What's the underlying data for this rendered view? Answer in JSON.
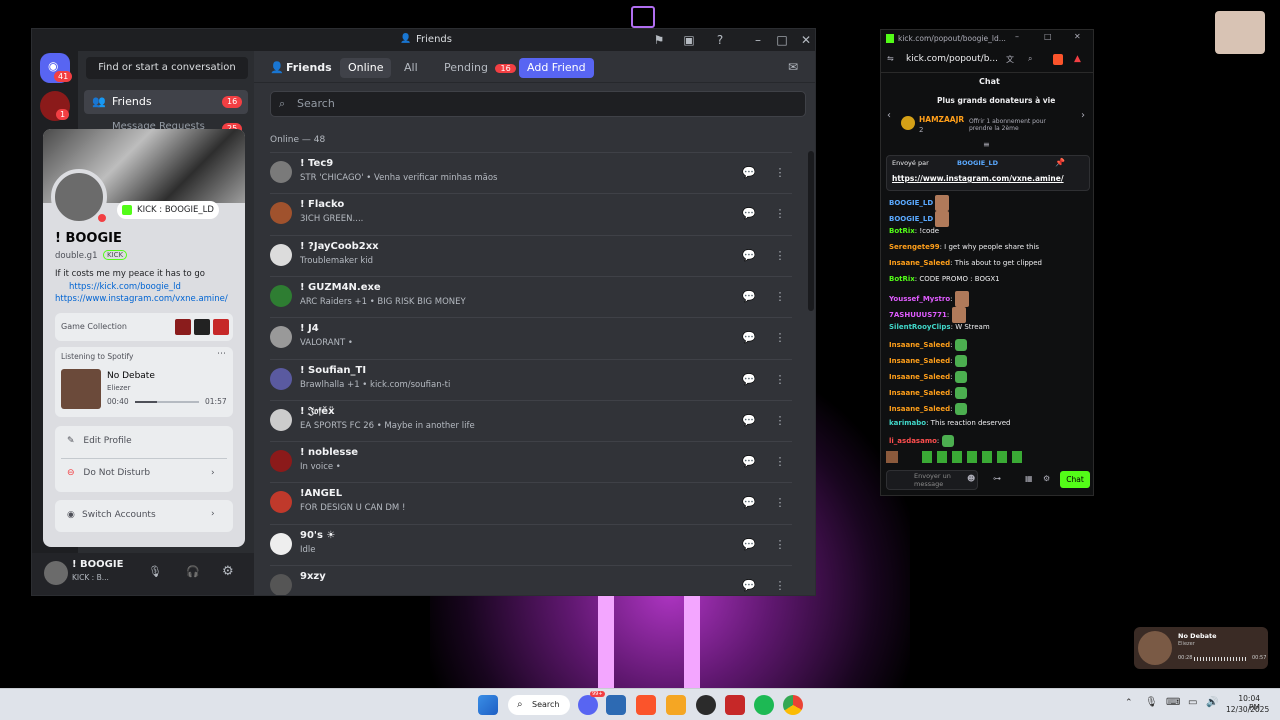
{
  "discord": {
    "window_title": "Friends",
    "server_badges": [
      "41",
      "1"
    ],
    "find_btn": "Find or start a conversation",
    "friends_label": "Friends",
    "friends_badge": "16",
    "msg_requests": "Message Requests",
    "msg_requests_badge": "25",
    "nav": {
      "friends": "Friends",
      "online": "Online",
      "all": "All",
      "pending": "Pending",
      "pending_badge": "16",
      "add_friend": "Add Friend"
    },
    "search_placeholder": "Search",
    "online_header": "Online — 48",
    "rows": [
      {
        "name": "! Tec9",
        "status": "STR 'CHICAGO' • Venha verificar minhas mãos"
      },
      {
        "name": "! Flacko",
        "status": "3ICH GREEN...."
      },
      {
        "name": "! ?JayCoob2xx",
        "status": "Troublemaker kid"
      },
      {
        "name": "! GUZM4N.exe",
        "status": "ARC Raiders +1 • BIG RISK BIG MONEY"
      },
      {
        "name": "! J4",
        "status": "VALORANT •"
      },
      {
        "name": "! Soufian_TI",
        "status": "Brawlhalla +1 • kick.com/soufian-ti"
      },
      {
        "name": "! 𝔍𝔬𝔣ĕẍ",
        "status": "EA SPORTS FC 26 • Maybe in another life"
      },
      {
        "name": "! noblesse",
        "status": "In voice •"
      },
      {
        "name": "!ANGEL",
        "status": "FOR DESIGN U CAN DM !"
      },
      {
        "name": "90's ☀",
        "status": "Idle"
      },
      {
        "name": "9xzy",
        "status": ""
      }
    ],
    "profile": {
      "kick_pill": "KICK : BOOGIE_LD",
      "name": "! BOOGIE",
      "handle": "double.g1",
      "kick_tag": "KICK",
      "bio1": "If it costs me my peace it has to go",
      "bio_link1": "https://kick.com/boogie_ld",
      "bio_link2": "https://www.instagram.com/vxne.amine/",
      "game_collection": "Game Collection",
      "spotify_label": "Listening to Spotify",
      "song": "No Debate",
      "artist": "Eliezer",
      "time_start": "00:40",
      "time_end": "01:57",
      "song_progress": 0.34,
      "edit_profile": "Edit Profile",
      "dnd": "Do Not Disturb",
      "switch_accounts": "Switch Accounts"
    },
    "user_panel": {
      "name": "! BOOGIE",
      "sub": "KICK : B..."
    }
  },
  "kick": {
    "url_title": "kick.com/popout/boogie_ld...",
    "url": "kick.com/popout/b...",
    "chat_header": "Chat",
    "donors_title": "Plus grands donateurs à vie",
    "top_donor": "HAMZAAJR",
    "top_donor_count": "2",
    "sub_offer": "Offrir 1 abonnement pour prendre la 2ème",
    "pinned_by": "Envoyé par",
    "pinned_user": "BOOGIE_LD",
    "pinned_link": "https://www.instagram.com/vxne.amine/",
    "messages": [
      {
        "user": "BOOGIE_LD",
        "text": ""
      },
      {
        "user": "BOOGIE_LD",
        "text": ""
      },
      {
        "user": "BotRix",
        "text": ": !code"
      },
      {
        "user": "Serengete99",
        "text": ": I get why people share this"
      },
      {
        "user": "Insaane_Saleed",
        "text": ": This about to get clipped"
      },
      {
        "user": "BotRix",
        "text": ": CODE PROMO : BOGX1"
      },
      {
        "user": "Youssef_Mystro",
        "text": ":"
      },
      {
        "user": "7ASHUUUS771",
        "text": ":"
      },
      {
        "user": "SilentRooyClips",
        "text": ": W Stream"
      },
      {
        "user": "Insaane_Saleed",
        "text": ":"
      },
      {
        "user": "Insaane_Saleed",
        "text": ":"
      },
      {
        "user": "Insaane_Saleed",
        "text": ":"
      },
      {
        "user": "Insaane_Saleed",
        "text": ":"
      },
      {
        "user": "Insaane_Saleed",
        "text": ":"
      },
      {
        "user": "karimabo",
        "text": ": This reaction deserved"
      },
      {
        "user": "li_asdasamo",
        "text": ":"
      }
    ],
    "input_placeholder": "Envoyer un message",
    "chat_btn": "Chat"
  },
  "mini_player": {
    "title": "No Debate",
    "sub": "Eliezer",
    "t1": "00:28",
    "t2": "00:57"
  },
  "taskbar": {
    "search": "Search",
    "time": "10:04 PM",
    "date": "12/30/2025",
    "badge": "99+"
  },
  "colors": {
    "blurple": "#5865f2",
    "red": "#f23f43",
    "kick_green": "#53fc18"
  }
}
